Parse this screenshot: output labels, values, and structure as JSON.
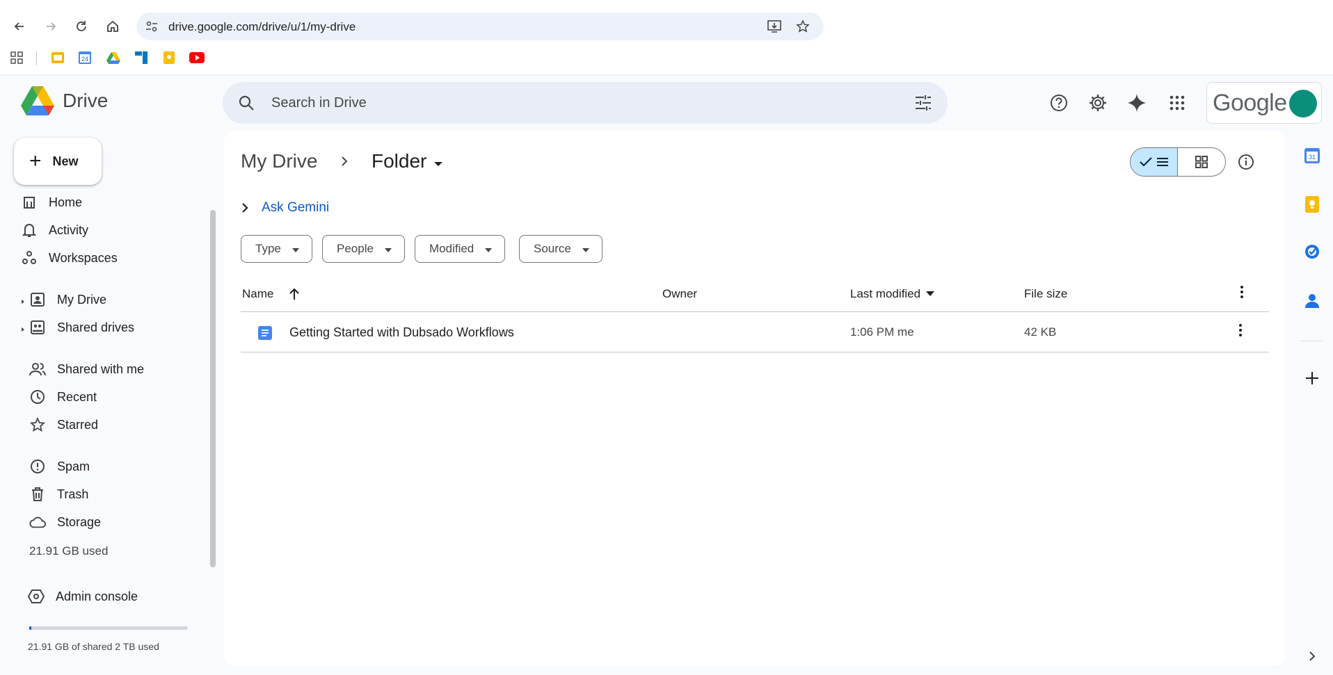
{
  "browser": {
    "url": "drive.google.com/drive/u/1/my-drive",
    "bookmark_icons": [
      "apps-icon",
      "slides-bookmark-icon",
      "calendar-bookmark-icon",
      "drive-bookmark-icon",
      "trello-bookmark-icon",
      "keep-bookmark-icon",
      "youtube-bookmark-icon"
    ],
    "calendar_day": "24"
  },
  "app": {
    "name": "Drive",
    "search_placeholder": "Search in Drive",
    "account_brand": "Google"
  },
  "sidebar": {
    "new_label": "New",
    "items": [
      {
        "label": "Home",
        "icon": "home-icon"
      },
      {
        "label": "Activity",
        "icon": "bell-icon"
      },
      {
        "label": "Workspaces",
        "icon": "workspaces-icon"
      },
      {
        "label": "My Drive",
        "icon": "my-drive-icon"
      },
      {
        "label": "Shared drives",
        "icon": "shared-drives-icon"
      },
      {
        "label": "Shared with me",
        "icon": "people-icon"
      },
      {
        "label": "Recent",
        "icon": "clock-icon"
      },
      {
        "label": "Starred",
        "icon": "star-icon"
      },
      {
        "label": "Spam",
        "icon": "spam-icon"
      },
      {
        "label": "Trash",
        "icon": "trash-icon"
      },
      {
        "label": "Storage",
        "icon": "cloud-icon"
      }
    ],
    "used": "21.91 GB used",
    "admin_label": "Admin console",
    "storage_text": "21.91 GB of shared 2 TB used"
  },
  "main": {
    "breadcrumb_root": "My Drive",
    "breadcrumb_current": "Folder",
    "ask_gemini": "Ask Gemini",
    "filters": [
      "Type",
      "People",
      "Modified",
      "Source"
    ],
    "columns": {
      "name": "Name",
      "owner": "Owner",
      "last_modified": "Last modified",
      "file_size": "File size"
    },
    "files": [
      {
        "name": "Getting Started with Dubsado Workflows",
        "modified": "1:06 PM me",
        "size": "42 KB",
        "owner": ""
      }
    ]
  },
  "colors": {
    "accent": "#0b57d0",
    "docs_blue": "#4285f4",
    "avatar": "#0b8f7c"
  }
}
